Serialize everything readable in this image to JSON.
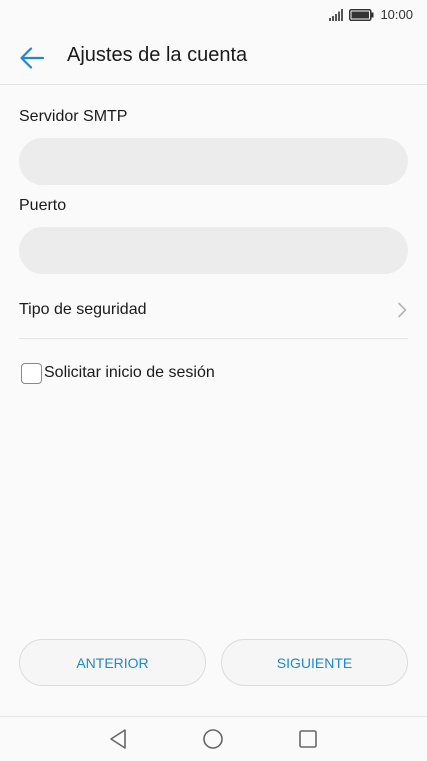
{
  "status_bar": {
    "time": "10:00",
    "icons": [
      "signal-icon",
      "battery-icon"
    ]
  },
  "app_bar": {
    "title": "Ajustes de la cuenta",
    "back_icon": "arrow-left-icon"
  },
  "form": {
    "smtp_server": {
      "label": "Servidor SMTP",
      "value": "",
      "placeholder": ""
    },
    "port": {
      "label": "Puerto",
      "value": "",
      "placeholder": ""
    },
    "security_type": {
      "label": "Tipo de seguridad",
      "icon": "chevron-right-icon"
    },
    "require_signin": {
      "label": "Solicitar inicio de sesión",
      "checked": false
    }
  },
  "actions": {
    "previous_label": "ANTERIOR",
    "next_label": "SIGUIENTE"
  },
  "nav_bar": {
    "icons": [
      "nav-back-icon",
      "nav-home-icon",
      "nav-recents-icon"
    ]
  },
  "colors": {
    "accent": "#1f87d6",
    "background": "#fafafa",
    "input_background": "#ececec"
  }
}
